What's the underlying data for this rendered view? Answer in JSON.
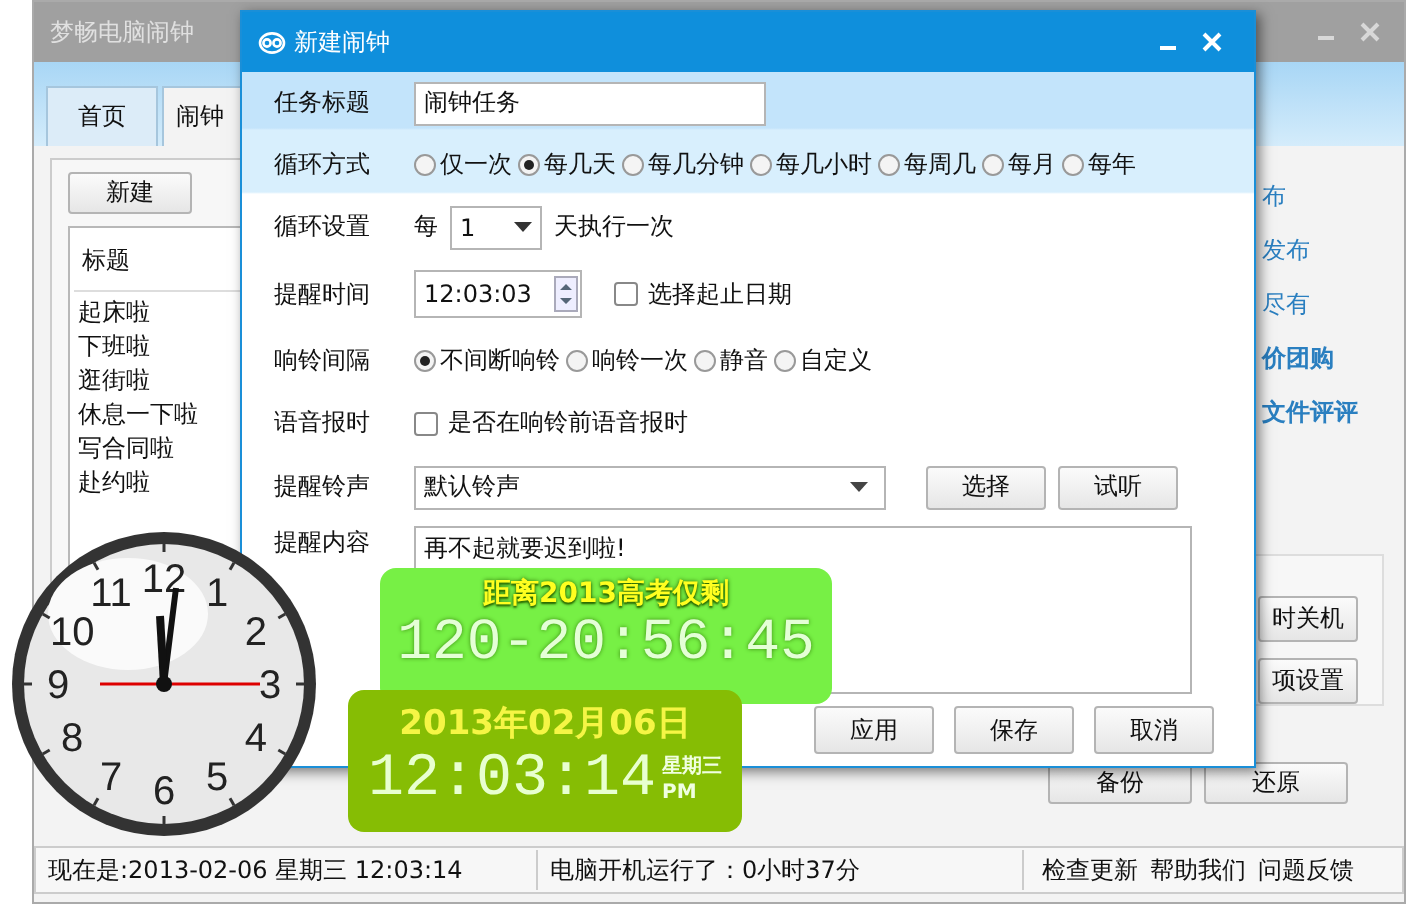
{
  "main_window": {
    "title": "梦畅电脑闹钟",
    "tabs": [
      {
        "label": "首页",
        "selected": false
      },
      {
        "label": "闹钟",
        "selected": true
      }
    ],
    "new_button": "新建",
    "list": {
      "header": "标题",
      "items": [
        "起床啦",
        "下班啦",
        "逛街啦",
        "休息一下啦",
        "写合同啦",
        "赴约啦"
      ]
    },
    "side_links": [
      {
        "label": "布",
        "bold": false
      },
      {
        "label": "发布",
        "bold": false
      },
      {
        "label": "尽有",
        "bold": false
      },
      {
        "label": "价团购",
        "bold": true
      },
      {
        "label": "文件评评",
        "bold": true
      }
    ],
    "side_buttons": [
      "时关机",
      "项设置"
    ],
    "bottom_buttons": [
      "备份",
      "还原"
    ],
    "status_bar": {
      "now": "现在是:2013-02-06 星期三  12:03:14",
      "uptime": "电脑开机运行了：0小时37分",
      "links": [
        "检查更新",
        "帮助我们",
        "问题反馈"
      ]
    }
  },
  "dialog": {
    "title": "新建闹钟",
    "fields": [
      {
        "kind": "text",
        "label": "任务标题",
        "value": "闹钟任务"
      },
      {
        "kind": "radio",
        "label": "循环方式",
        "options": [
          {
            "label": "仅一次",
            "selected": false
          },
          {
            "label": "每几天",
            "selected": true
          },
          {
            "label": "每几分钟",
            "selected": false
          },
          {
            "label": "每几小时",
            "selected": false
          },
          {
            "label": "每周几",
            "selected": false
          },
          {
            "label": "每月",
            "selected": false
          },
          {
            "label": "每年",
            "selected": false
          }
        ]
      },
      {
        "kind": "repeat",
        "label": "循环设置",
        "prefix": "每",
        "value": "1",
        "suffix": "天执行一次"
      },
      {
        "kind": "time",
        "label": "提醒时间",
        "value": "12:03:03",
        "checkbox": {
          "label": "选择起止日期",
          "checked": false
        }
      },
      {
        "kind": "radio",
        "label": "响铃间隔",
        "options": [
          {
            "label": "不间断响铃",
            "selected": true
          },
          {
            "label": "响铃一次",
            "selected": false
          },
          {
            "label": "静音",
            "selected": false
          },
          {
            "label": "自定义",
            "selected": false
          }
        ]
      },
      {
        "kind": "check",
        "label": "语音报时",
        "checkbox": {
          "label": "是否在响铃前语音报时",
          "checked": false
        }
      },
      {
        "kind": "sound",
        "label": "提醒铃声",
        "value": "默认铃声",
        "buttons": [
          "选择",
          "试听"
        ]
      },
      {
        "kind": "textarea",
        "label": "提醒内容",
        "value": "再不起就要迟到啦!"
      }
    ],
    "buttons": [
      "应用",
      "保存",
      "取消"
    ]
  },
  "countdown_widget": {
    "caption": "距离2013高考仅剩",
    "reading": "120-20:56:45"
  },
  "date_widget": {
    "date": "2013年02月06日",
    "time": "12:03:14",
    "weekday": "星期三",
    "ampm": "PM"
  },
  "analog_clock": {
    "numerals": [
      "12",
      "11",
      "1",
      "10",
      "2",
      "9",
      "3",
      "8",
      "4",
      "7",
      "5",
      "6"
    ]
  }
}
